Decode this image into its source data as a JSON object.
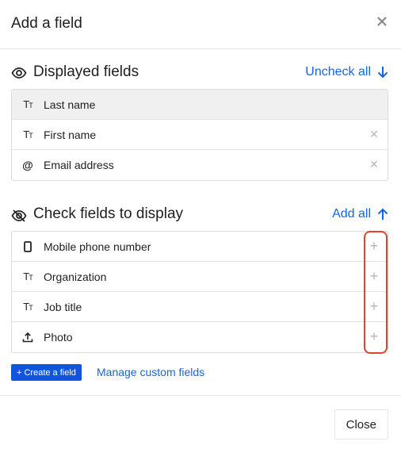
{
  "dialog": {
    "title": "Add a field"
  },
  "displayed": {
    "heading": "Displayed fields",
    "action_label": "Uncheck all",
    "items": [
      {
        "icon": "text-icon",
        "label": "Last name",
        "removable": false
      },
      {
        "icon": "text-icon",
        "label": "First name",
        "removable": true
      },
      {
        "icon": "at-sign-icon",
        "label": "Email address",
        "removable": true
      }
    ]
  },
  "available": {
    "heading": "Check fields to display",
    "action_label": "Add all",
    "items": [
      {
        "icon": "phone-icon",
        "label": "Mobile phone number"
      },
      {
        "icon": "text-icon",
        "label": "Organization"
      },
      {
        "icon": "text-icon",
        "label": "Job title"
      },
      {
        "icon": "upload-icon",
        "label": "Photo"
      }
    ]
  },
  "create_button": "+ Create a field",
  "manage_link": "Manage custom fields",
  "footer": {
    "close_label": "Close"
  },
  "colors": {
    "accent": "#1565e0",
    "button": "#1155dd",
    "highlight": "#d9472b"
  }
}
